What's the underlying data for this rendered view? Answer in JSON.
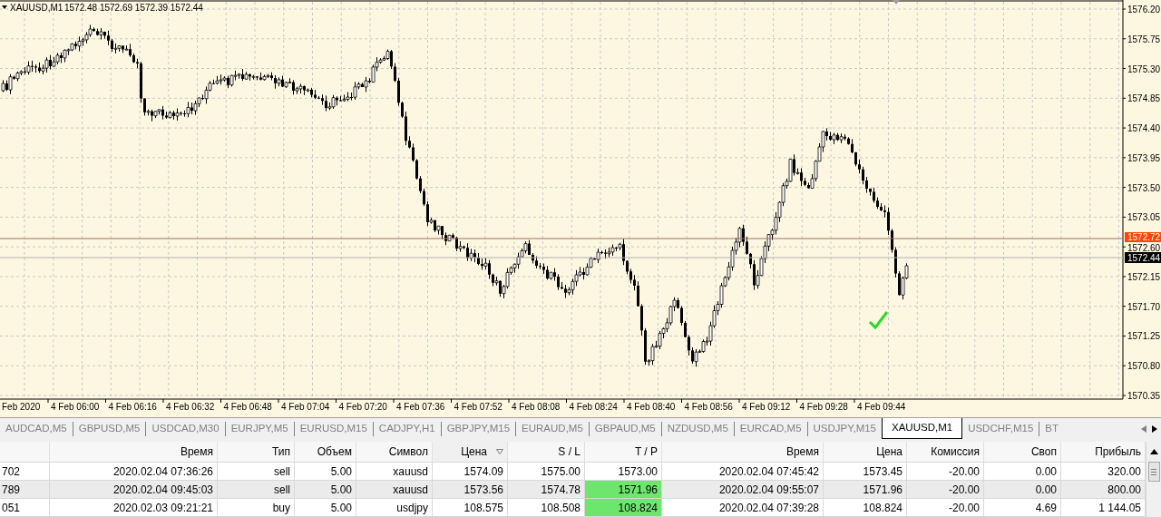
{
  "chart": {
    "title": "XAUUSD,M1",
    "ohlc": "1572.48 1572.69 1572.39 1572.44",
    "price_labels": [
      "1576.20",
      "1575.75",
      "1575.30",
      "1574.85",
      "1574.40",
      "1573.95",
      "1573.50",
      "1573.05",
      "1572.60",
      "1572.15",
      "1571.70",
      "1571.25",
      "1570.80",
      "1570.35"
    ],
    "ask_marker": "1572.72",
    "bid_marker": "1572.44",
    "time_labels": [
      "Feb 2020",
      "4 Feb 06:00",
      "4 Feb 06:16",
      "4 Feb 06:32",
      "4 Feb 06:48",
      "4 Feb 07:04",
      "4 Feb 07:20",
      "4 Feb 07:36",
      "4 Feb 07:52",
      "4 Feb 08:08",
      "4 Feb 08:24",
      "4 Feb 08:40",
      "4 Feb 08:56",
      "4 Feb 09:12",
      "4 Feb 09:28",
      "4 Feb 09:44"
    ]
  },
  "tabs": [
    {
      "label": "AUDCAD,M5",
      "selected": false
    },
    {
      "label": "GBPUSD,M5",
      "selected": false
    },
    {
      "label": "USDCAD,M30",
      "selected": false
    },
    {
      "label": "EURJPY,M5",
      "selected": false
    },
    {
      "label": "EURUSD,M15",
      "selected": false
    },
    {
      "label": "CADJPY,H1",
      "selected": false
    },
    {
      "label": "GBPJPY,M15",
      "selected": false
    },
    {
      "label": "EURAUD,M5",
      "selected": false
    },
    {
      "label": "GBPAUD,M5",
      "selected": false
    },
    {
      "label": "NZDUSD,M5",
      "selected": false
    },
    {
      "label": "EURCAD,M5",
      "selected": false
    },
    {
      "label": "USDJPY,M15",
      "selected": false
    },
    {
      "label": "XAUUSD,M1",
      "selected": true
    },
    {
      "label": "USDCHF,M15",
      "selected": false
    },
    {
      "label": "BT",
      "selected": false
    }
  ],
  "table": {
    "columns": [
      {
        "sorted": false
      },
      {
        "label": "Время",
        "sorted": false
      },
      {
        "label": "Тип",
        "sorted": false
      },
      {
        "label": "Объем",
        "sorted": false
      },
      {
        "label": "Символ",
        "sorted": false
      },
      {
        "label": "Цена",
        "sorted": true
      },
      {
        "label": "S / L",
        "sorted": false
      },
      {
        "label": "T / P",
        "sorted": false
      },
      {
        "label": "Время",
        "sorted": false
      },
      {
        "label": "Цена",
        "sorted": false
      },
      {
        "label": "Комиссия",
        "sorted": false
      },
      {
        "label": "Своп",
        "sorted": false
      },
      {
        "label": "Прибыль",
        "sorted": false
      }
    ],
    "rows": [
      {
        "selected": false,
        "tp_hit": false,
        "cells": [
          "702",
          "2020.02.04 07:36:26",
          "sell",
          "5.00",
          "xauusd",
          "1574.09",
          "1575.00",
          "1573.00",
          "2020.02.04 07:45:42",
          "1573.45",
          "-20.00",
          "0.00",
          "320.00"
        ]
      },
      {
        "selected": true,
        "tp_hit": true,
        "cells": [
          "789",
          "2020.02.04 09:45:03",
          "sell",
          "5.00",
          "xauusd",
          "1573.56",
          "1574.78",
          "1571.96",
          "2020.02.04 09:55:07",
          "1571.96",
          "-20.00",
          "0.00",
          "800.00"
        ]
      },
      {
        "selected": false,
        "tp_hit": true,
        "cells": [
          "051",
          "2020.02.03 09:21:21",
          "buy",
          "5.00",
          "usdjpy",
          "108.575",
          "108.508",
          "108.824",
          "2020.02.04 07:39:28",
          "108.824",
          "-20.00",
          "4.69",
          "1 144.05"
        ]
      }
    ]
  }
}
